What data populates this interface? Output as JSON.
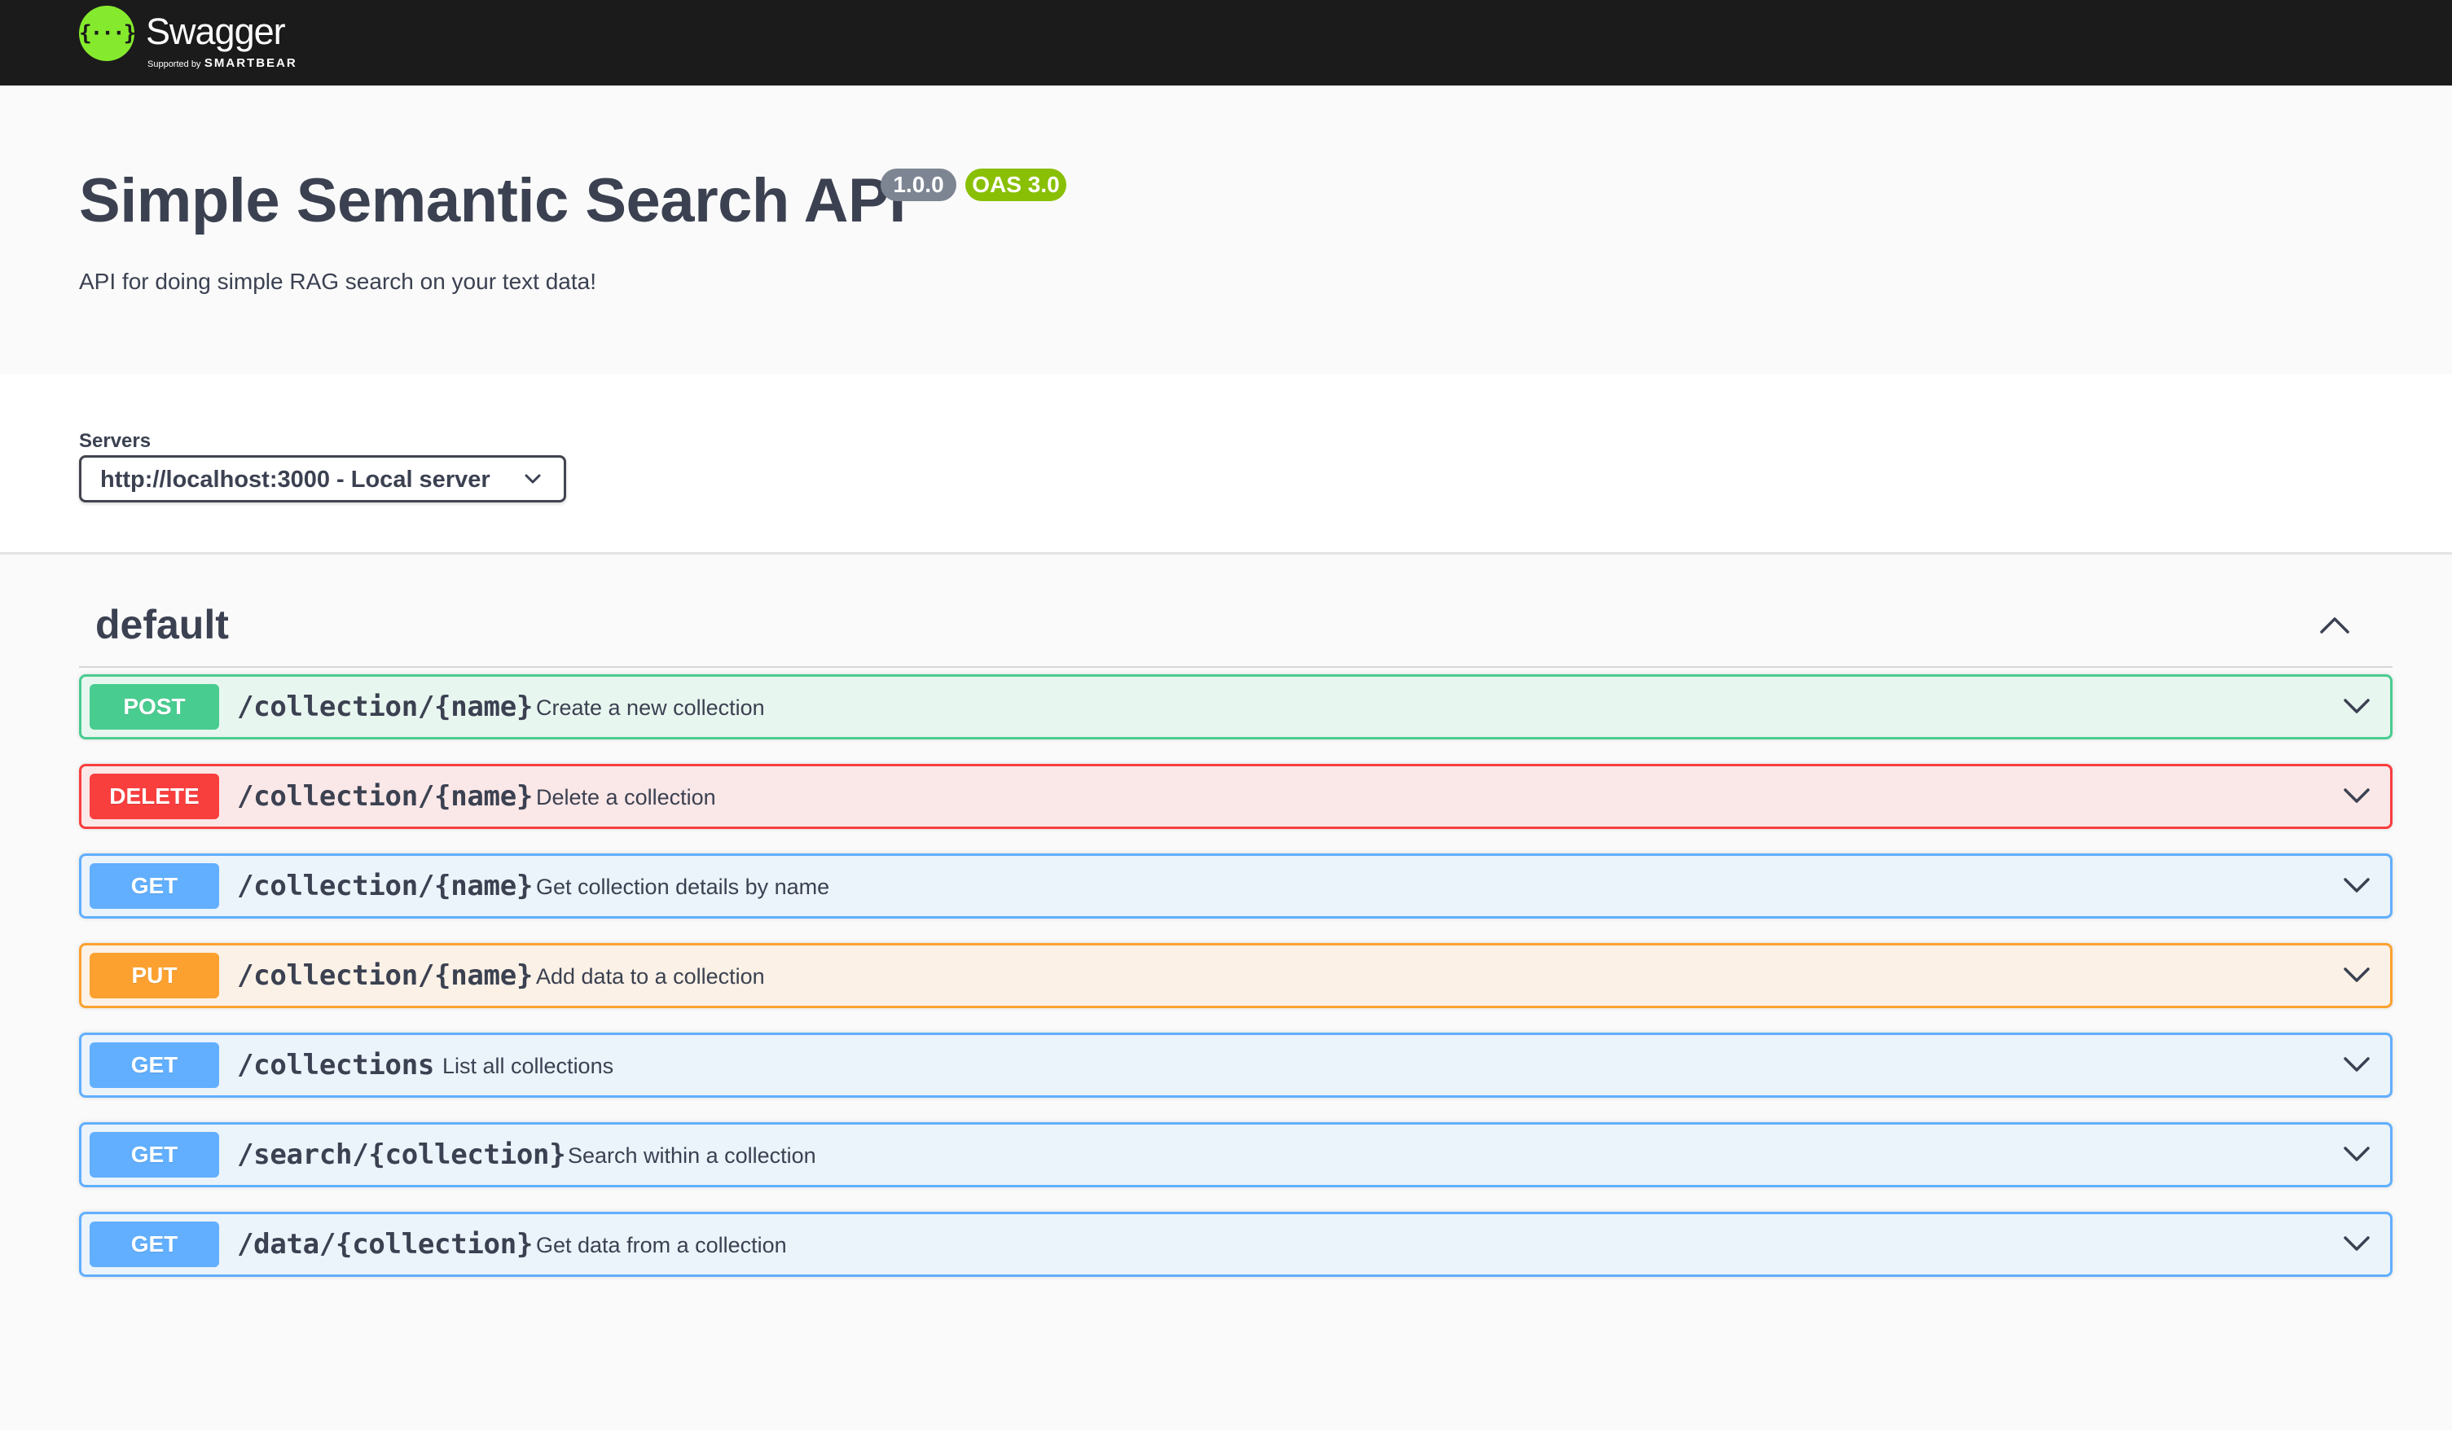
{
  "topbar": {
    "logo_glyph": "{···}",
    "logo_name": "Swagger",
    "logo_sub_small": "Supported by",
    "logo_sub_brand": "SMARTBEAR",
    "logo_color": "#85ea2d",
    "bar_color": "#1b1b1b"
  },
  "info": {
    "title": "Simple Semantic Search API",
    "version": "1.0.0",
    "oas": "OAS 3.0",
    "description": "API for doing simple RAG search on your text data!"
  },
  "servers": {
    "label": "Servers",
    "selected": "http://localhost:3000 - Local server",
    "icon": "chevron-down-icon"
  },
  "tag": {
    "name": "default",
    "icon": "chevron-up-icon"
  },
  "operations": [
    {
      "method": "POST",
      "path": "/collection/{name}",
      "summary": "Create a new collection",
      "color": "#49cc90"
    },
    {
      "method": "DELETE",
      "path": "/collection/{name}",
      "summary": "Delete a collection",
      "color": "#f93e3e"
    },
    {
      "method": "GET",
      "path": "/collection/{name}",
      "summary": "Get collection details by name",
      "color": "#61affe"
    },
    {
      "method": "PUT",
      "path": "/collection/{name}",
      "summary": "Add data to a collection",
      "color": "#fca130"
    },
    {
      "method": "GET",
      "path": "/collections",
      "summary": "List all collections",
      "color": "#61affe"
    },
    {
      "method": "GET",
      "path": "/search/{collection}",
      "summary": "Search within a collection",
      "color": "#61affe"
    },
    {
      "method": "GET",
      "path": "/data/{collection}",
      "summary": "Get data from a collection",
      "color": "#61affe"
    }
  ]
}
